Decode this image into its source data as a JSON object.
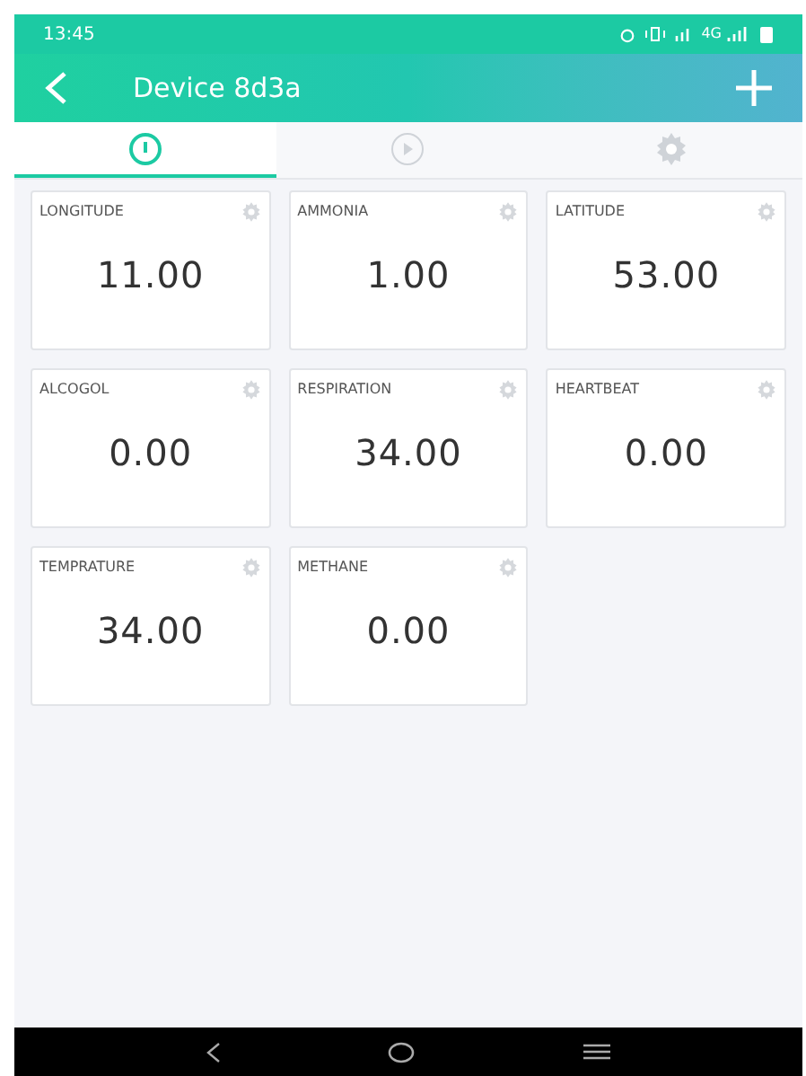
{
  "status_bar": {
    "time": "13:45",
    "network": "4G"
  },
  "header": {
    "title": "Device 8d3a"
  },
  "tabs": [
    {
      "kind": "dashboard",
      "selected": true
    },
    {
      "kind": "play",
      "selected": false
    },
    {
      "kind": "settings",
      "selected": false
    }
  ],
  "widgets": [
    {
      "label": "LONGITUDE",
      "value": "11.00"
    },
    {
      "label": "AMMONIA",
      "value": "1.00"
    },
    {
      "label": "LATITUDE",
      "value": "53.00"
    },
    {
      "label": "ALCOGOL",
      "value": "0.00"
    },
    {
      "label": "RESPIRATION",
      "value": "34.00"
    },
    {
      "label": "HEARTBEAT",
      "value": "0.00"
    },
    {
      "label": "TEMPRATURE",
      "value": "34.00"
    },
    {
      "label": "METHANE",
      "value": "0.00"
    }
  ]
}
